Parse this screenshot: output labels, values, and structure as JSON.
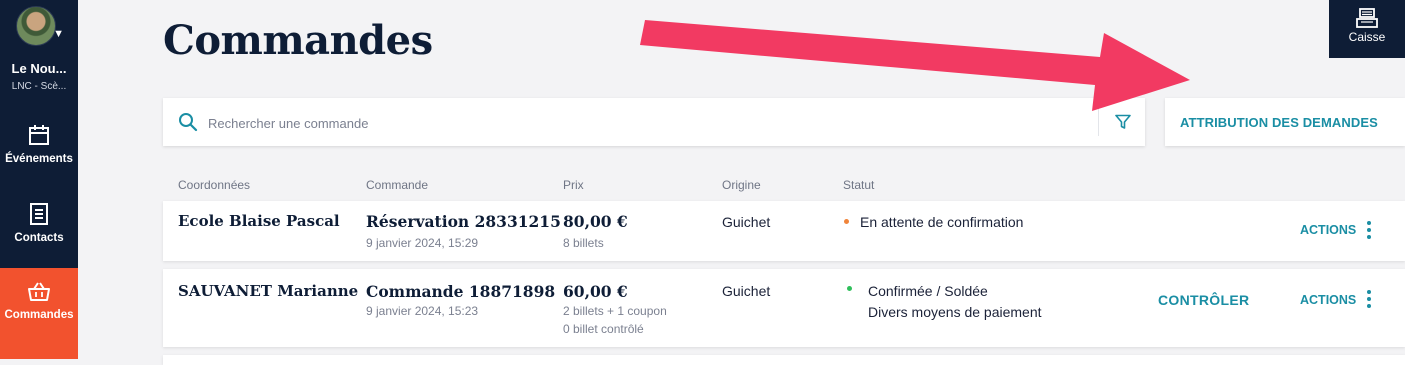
{
  "sidebar": {
    "org_name": "Le Nou...",
    "org_sub": "LNC - Scè...",
    "items": [
      {
        "label": "Événements",
        "icon": "calendar-icon"
      },
      {
        "label": "Contacts",
        "icon": "contacts-list-icon"
      },
      {
        "label": "Commandes",
        "icon": "basket-icon",
        "active": true
      }
    ]
  },
  "header": {
    "title": "Commandes",
    "caisse_label": "Caisse"
  },
  "search": {
    "placeholder": "Rechercher une commande",
    "value": ""
  },
  "attribution_label": "ATTRIBUTION DES DEMANDES",
  "table": {
    "columns": [
      "Coordonnées",
      "Commande",
      "Prix",
      "Origine",
      "Statut"
    ],
    "rows": [
      {
        "contact": "Ecole Blaise Pascal",
        "order": "Réservation 28331215",
        "date": "9 janvier 2024, 15:29",
        "price": "80,00 €",
        "price_detail": "8 billets",
        "price_detail2": "",
        "origin": "Guichet",
        "status": "En attente de confirmation",
        "status_detail": "",
        "status_color": "#f0843a",
        "control_label": "",
        "actions_label": "ACTIONS"
      },
      {
        "contact": "SAUVANET Marianne",
        "order": "Commande 18871898",
        "date": "9 janvier 2024, 15:23",
        "price": "60,00 €",
        "price_detail": "2 billets + 1 coupon",
        "price_detail2": "0 billet contrôlé",
        "origin": "Guichet",
        "status": "Confirmée / Soldée",
        "status_detail": "Divers moyens de paiement",
        "status_color": "#2fbf5b",
        "control_label": "CONTRÔLER",
        "actions_label": "ACTIONS"
      }
    ]
  },
  "colors": {
    "navy": "#0e1d36",
    "accent": "#1a8ea4",
    "active_nav": "#f2522e",
    "annotation_arrow": "#f23a62"
  }
}
